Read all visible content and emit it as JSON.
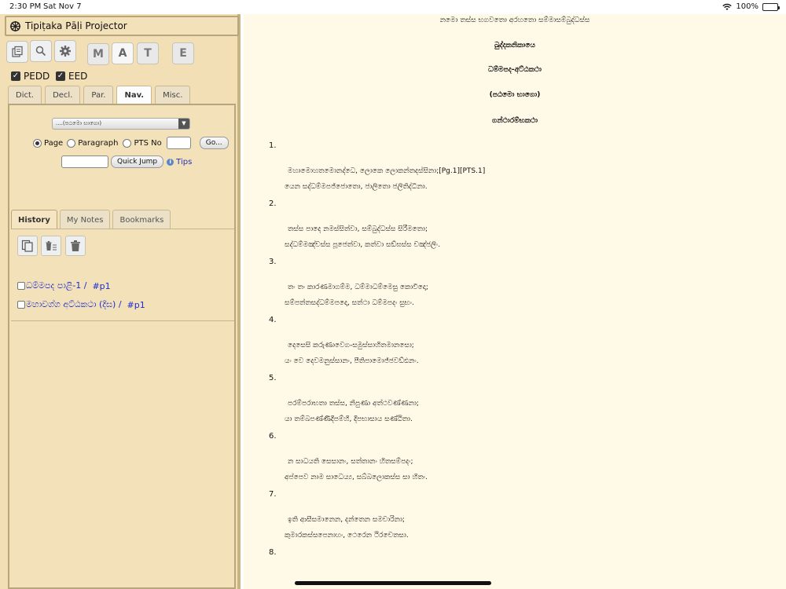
{
  "status": {
    "time": "2:30 PM",
    "date": "Sat Nov 7",
    "battery": "100%"
  },
  "app": {
    "title": "Tipiṭaka Pāḷi Projector"
  },
  "toolbar": {
    "lang_buttons": [
      "M",
      "A",
      "T",
      "E"
    ]
  },
  "dicts": {
    "pedd": "PEDD",
    "eed": "EED"
  },
  "tabs": [
    "Dict.",
    "Decl.",
    "Par.",
    "Nav.",
    "Misc."
  ],
  "nav": {
    "select_value": "....(පඨමො භාගො)",
    "radio_page": "Page",
    "radio_paragraph": "Paragraph",
    "radio_pts": "PTS No",
    "go": "Go...",
    "quick_jump": "Quick Jump",
    "tips": "Tips"
  },
  "history_tabs": [
    "History",
    "My Notes",
    "Bookmarks"
  ],
  "history": [
    {
      "text": "ධම්මපද පාළි-1 /",
      "link": "#p1"
    },
    {
      "text": "මහාවග්ග අට්ඨකථා (දීඝ) /",
      "link": "#p1"
    }
  ],
  "doc": {
    "header": "නමො තස්ස භගවතො අරහතො සම්මාසම්බුද්ධස්ස",
    "nikaya": "ඛුද්දකනිකායෙ",
    "title": "ධම්මපද-අට්ඨකථා",
    "part": "(පඨමො භාගො)",
    "section": "ගන්ථාරම්භකථා",
    "verses": [
      {
        "n": "1.",
        "l1": "මහාමොහතමොනද්ධෙ, ලොකෙ ලොකන්තදස්සිනා;[Pg.1][PTS.1]",
        "l2": "යෙන සද්ධම්මපජ්ජොතො, ජාලිතො ජලිතිද්ධිනා."
      },
      {
        "n": "2.",
        "l1": "තස්ස පාදෙ නමස්සිත්වා, සම්බුද්ධස්ස සිරීමතො;",
        "l2": "සද්ධම්මඤ්චස්ස පූජෙත්වා, කත්වා සඞ්ඝස්ස චඤ්ජලිං."
      },
      {
        "n": "3.",
        "l1": "තං තං කාරණමාගම්ම, ධම්මාධම්මෙසු කොවිදො;",
        "l2": "සම්පත්තසද්ධම්මපදො, සත්ථා ධම්මපදං සුභං."
      },
      {
        "n": "4.",
        "l1": "දෙසෙසි කරුණාවෙග-සමුස්සාහිතමානසො;",
        "l2": "යං වෙ දෙවමනුස්සානං, පීතිපාමොජ්ජවඩ්ඪනං."
      },
      {
        "n": "5.",
        "l1": "පරම්පරාභතා තස්ස, නිපුණා අත්ථවණ්ණනා;",
        "l2": "යා තම්බපණ්ණිදීපම්හි, දීපභාසාය සණ්ඨිතා."
      },
      {
        "n": "6.",
        "l1": "න සාධයති සෙසානං, සත්තානං හිතසම්පදං;",
        "l2": "අප්පෙව නාම සාධෙය්‍ය, සබ්බලොකස්ස සා හිතං."
      },
      {
        "n": "7.",
        "l1": "ඉති ආසීසමානෙන, දන්තෙන සමචාරිනා;",
        "l2": "කුමාරකස්සපෙනාහං, ථෙරෙන ථිරචෙතසා."
      },
      {
        "n": "8.",
        "l1": "",
        "l2": ""
      }
    ]
  }
}
